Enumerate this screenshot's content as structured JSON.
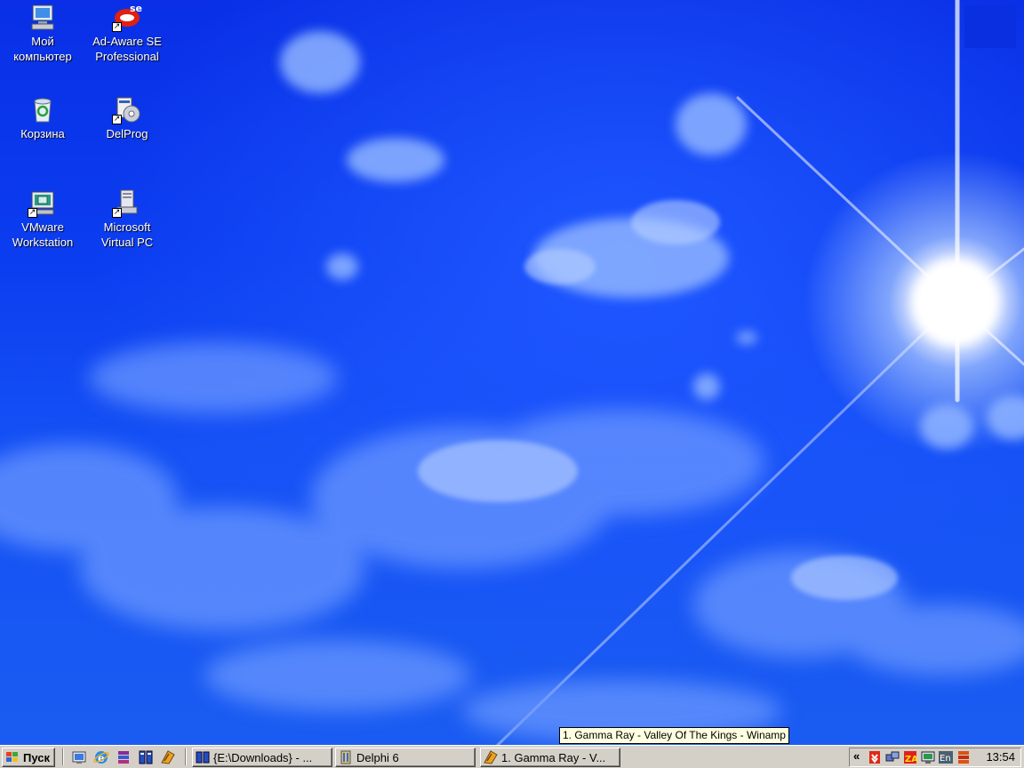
{
  "desktop": {
    "icons": [
      {
        "label": "Мой\nкомпьютер",
        "icon": "my-computer-icon",
        "shortcut": false
      },
      {
        "label": "Ad-Aware SE\nProfessional",
        "icon": "adaware-icon",
        "shortcut": true
      },
      {
        "label": "Корзина",
        "icon": "recycle-bin-icon",
        "shortcut": false
      },
      {
        "label": "DelProg",
        "icon": "delprog-icon",
        "shortcut": true
      },
      {
        "label": "VMware\nWorkstation",
        "icon": "vmware-icon",
        "shortcut": true
      },
      {
        "label": "Microsoft\nVirtual PC",
        "icon": "virtual-pc-icon",
        "shortcut": true
      }
    ]
  },
  "taskbar": {
    "start_label": "Пуск",
    "quick_launch": [
      "show-desktop-icon",
      "ie-icon",
      "winrar-icon",
      "total-commander-icon",
      "winamp-icon"
    ],
    "windows": [
      {
        "label": "{E:\\Downloads} - ...",
        "icon": "folder-app-icon"
      },
      {
        "label": "Delphi 6",
        "icon": "delphi-icon"
      },
      {
        "label": "1. Gamma Ray - V...",
        "icon": "winamp-icon"
      }
    ],
    "tray": {
      "chevron": "«",
      "icons": [
        "download-icon",
        "network-icon",
        "zonealarm-icon",
        "monitor-icon",
        "language-en-icon",
        "winrar-tray-icon"
      ],
      "language": "En",
      "clock": "13:54"
    },
    "tooltip": "1. Gamma Ray - Valley Of The Kings - Winamp"
  },
  "colors": {
    "sky": "#0b3df0",
    "taskbar": "#d4d0c8",
    "tooltip_bg": "#ffffe1"
  }
}
